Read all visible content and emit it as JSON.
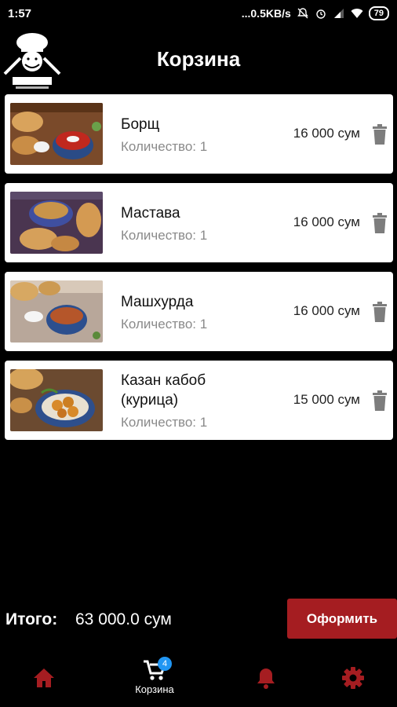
{
  "status_bar": {
    "time": "1:57",
    "network_speed": "...0.5KB/s",
    "battery": "79"
  },
  "header": {
    "title": "Корзина",
    "logo_icon": "chef-logo-icon"
  },
  "cart": {
    "items": [
      {
        "name": "Борщ",
        "quantity_label": "Количество: 1",
        "price": "16 000 сум",
        "image": "borscht-photo"
      },
      {
        "name": "Мастава",
        "quantity_label": "Количество: 1",
        "price": "16 000 сум",
        "image": "mastava-photo"
      },
      {
        "name": "Машхурда",
        "quantity_label": "Количество: 1",
        "price": "16 000 сум",
        "image": "mashkhurda-photo"
      },
      {
        "name": "Казан кабоб (курица)",
        "name_line1": "Казан кабоб",
        "name_line2": "(курица)",
        "quantity_label": "Количество: 1",
        "price": "15 000 сум",
        "image": "kazan-kabob-photo"
      }
    ]
  },
  "summary": {
    "total_label": "Итого:",
    "total_value": "63 000.0 сум",
    "checkout_label": "Оформить"
  },
  "bottom_nav": {
    "items": [
      {
        "icon": "home-icon",
        "label": ""
      },
      {
        "icon": "cart-icon",
        "label": "Корзина",
        "badge": "4"
      },
      {
        "icon": "bell-icon",
        "label": ""
      },
      {
        "icon": "gear-icon",
        "label": ""
      }
    ]
  },
  "colors": {
    "accent": "#a51d21",
    "badge": "#2196f3",
    "background": "#000000"
  }
}
